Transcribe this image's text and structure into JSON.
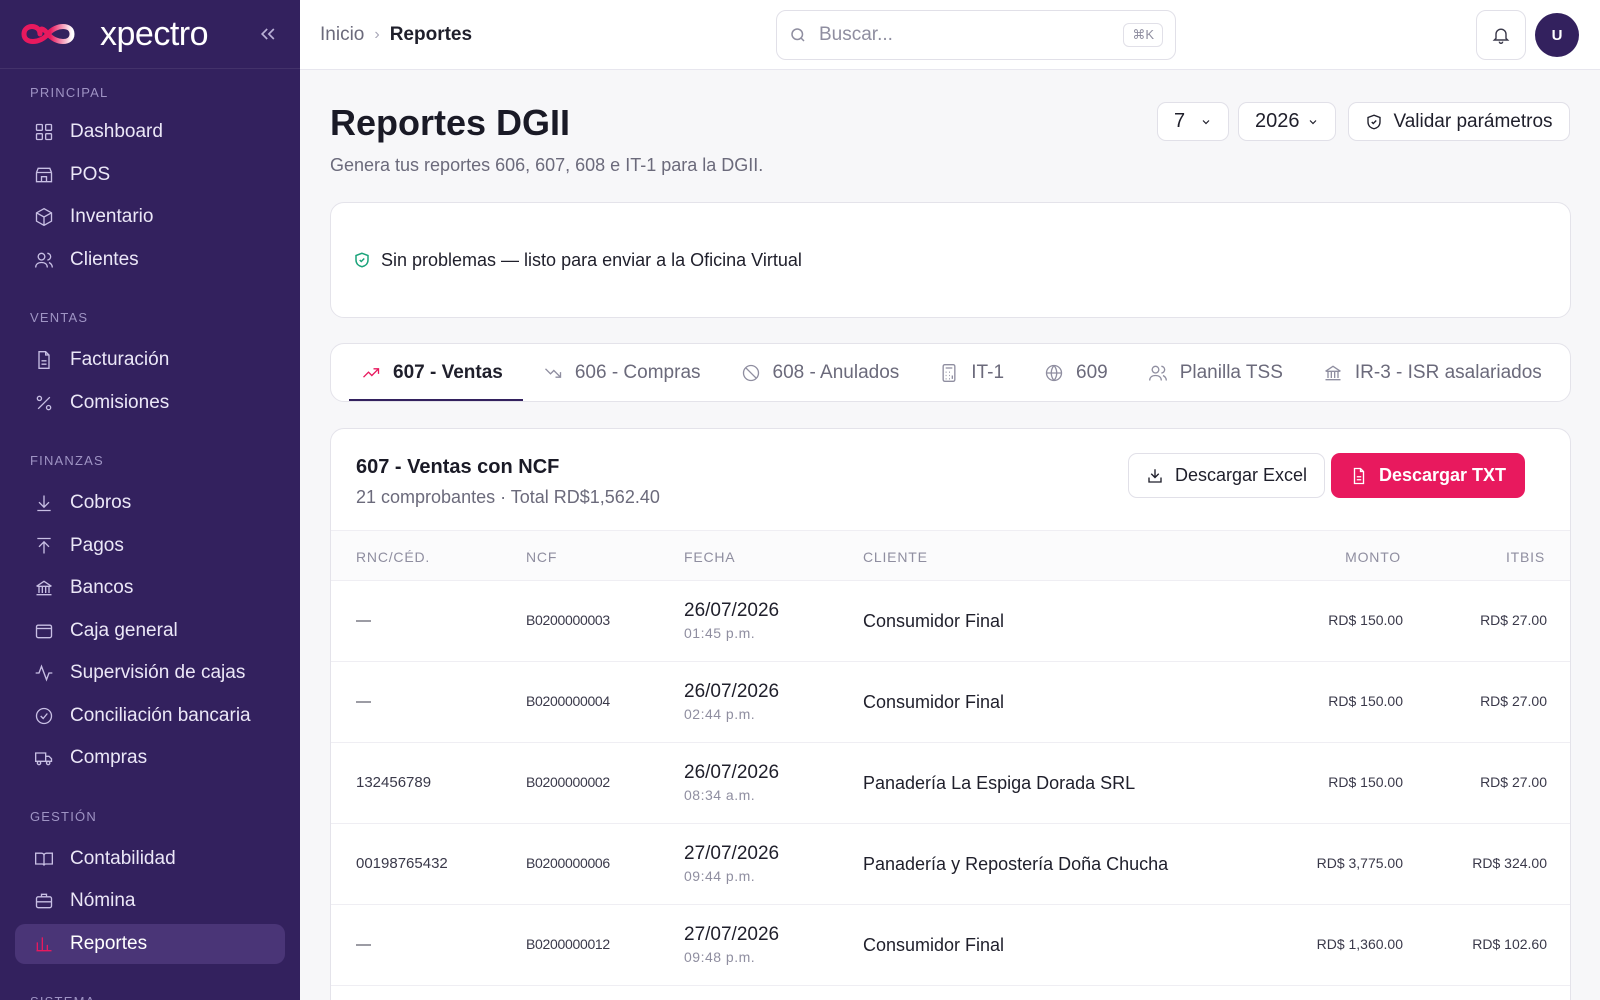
{
  "brand": {
    "name": "xpectro"
  },
  "sidebar": {
    "sections": [
      {
        "label": "PRINCIPAL",
        "items": [
          "Dashboard",
          "POS",
          "Inventario",
          "Clientes"
        ]
      },
      {
        "label": "VENTAS",
        "items": [
          "Facturación",
          "Comisiones"
        ]
      },
      {
        "label": "FINANZAS",
        "items": [
          "Cobros",
          "Pagos",
          "Bancos",
          "Caja general",
          "Supervisión de cajas",
          "Conciliación bancaria",
          "Compras"
        ]
      },
      {
        "label": "GESTIÓN",
        "items": [
          "Contabilidad",
          "Nómina",
          "Reportes"
        ]
      },
      {
        "label": "SISTEMA",
        "items": []
      }
    ],
    "active_item": "Reportes"
  },
  "topbar": {
    "breadcrumb": {
      "home": "Inicio",
      "current": "Reportes"
    },
    "search": {
      "placeholder": "Buscar...",
      "shortcut": "⌘K"
    },
    "avatar_initial": "U"
  },
  "page": {
    "title": "Reportes DGII",
    "subtitle": "Genera tus reportes 606, 607, 608 e IT-1 para la DGII.",
    "month": "7",
    "year": "2026",
    "validate_label": "Validar parámetros",
    "status_message": "Sin problemas — listo para enviar a la Oficina Virtual"
  },
  "tabs": [
    "607 - Ventas",
    "606 - Compras",
    "608 - Anulados",
    "IT-1",
    "609",
    "Planilla TSS",
    "IR-3 - ISR asalariados"
  ],
  "report": {
    "title": "607 - Ventas con NCF",
    "summary": "21 comprobantes · Total RD$1,562.40",
    "excel_label": "Descargar Excel",
    "txt_label": "Descargar TXT",
    "columns": [
      "RNC/CÉD.",
      "NCF",
      "FECHA",
      "CLIENTE",
      "MONTO",
      "ITBIS"
    ],
    "rows": [
      {
        "rnc": "—",
        "ncf": "B0200000003",
        "date": "26/07/2026",
        "time": "01:45 p.m.",
        "client": "Consumidor Final",
        "monto": "RD$ 150.00",
        "itbis": "RD$ 27.00"
      },
      {
        "rnc": "—",
        "ncf": "B0200000004",
        "date": "26/07/2026",
        "time": "02:44 p.m.",
        "client": "Consumidor Final",
        "monto": "RD$ 150.00",
        "itbis": "RD$ 27.00"
      },
      {
        "rnc": "132456789",
        "ncf": "B0200000002",
        "date": "26/07/2026",
        "time": "08:34 a.m.",
        "client": "Panadería La Espiga Dorada SRL",
        "monto": "RD$ 150.00",
        "itbis": "RD$ 27.00"
      },
      {
        "rnc": "00198765432",
        "ncf": "B0200000006",
        "date": "27/07/2026",
        "time": "09:44 p.m.",
        "client": "Panadería y Repostería Doña Chucha",
        "monto": "RD$ 3,775.00",
        "itbis": "RD$ 324.00"
      },
      {
        "rnc": "—",
        "ncf": "B0200000012",
        "date": "27/07/2026",
        "time": "09:48 p.m.",
        "client": "Consumidor Final",
        "monto": "RD$ 1,360.00",
        "itbis": "RD$ 102.60"
      }
    ]
  },
  "colors": {
    "sidebar": "#33215e",
    "accent": "#e8195e",
    "success": "#1aa37a"
  }
}
